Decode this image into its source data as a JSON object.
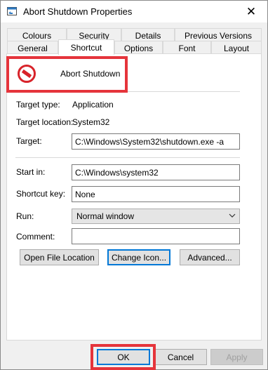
{
  "window": {
    "title": "Abort Shutdown Properties",
    "close_symbol": "✕",
    "icon": "window-icon"
  },
  "tabs_row1": [
    {
      "label": "Colours"
    },
    {
      "label": "Security"
    },
    {
      "label": "Details"
    },
    {
      "label": "Previous Versions"
    }
  ],
  "tabs_row2": [
    {
      "label": "General"
    },
    {
      "label": "Shortcut",
      "active": true
    },
    {
      "label": "Options"
    },
    {
      "label": "Font"
    },
    {
      "label": "Layout"
    }
  ],
  "shortcut": {
    "name": "Abort Shutdown",
    "icon": "no-entry-icon",
    "target_type_label": "Target type:",
    "target_type": "Application",
    "target_location_label": "Target location:",
    "target_location": "System32",
    "target_label": "Target:",
    "target": "C:\\Windows\\System32\\shutdown.exe -a",
    "start_in_label": "Start in:",
    "start_in": "C:\\Windows\\system32",
    "shortcut_key_label": "Shortcut key:",
    "shortcut_key": "None",
    "run_label": "Run:",
    "run": "Normal window",
    "comment_label": "Comment:",
    "comment": ""
  },
  "buttons": {
    "open_file_location": "Open File Location",
    "change_icon": "Change Icon...",
    "advanced": "Advanced...",
    "ok": "OK",
    "cancel": "Cancel",
    "apply": "Apply"
  },
  "colors": {
    "highlight": "#e5343b",
    "focus": "#0078d7"
  }
}
